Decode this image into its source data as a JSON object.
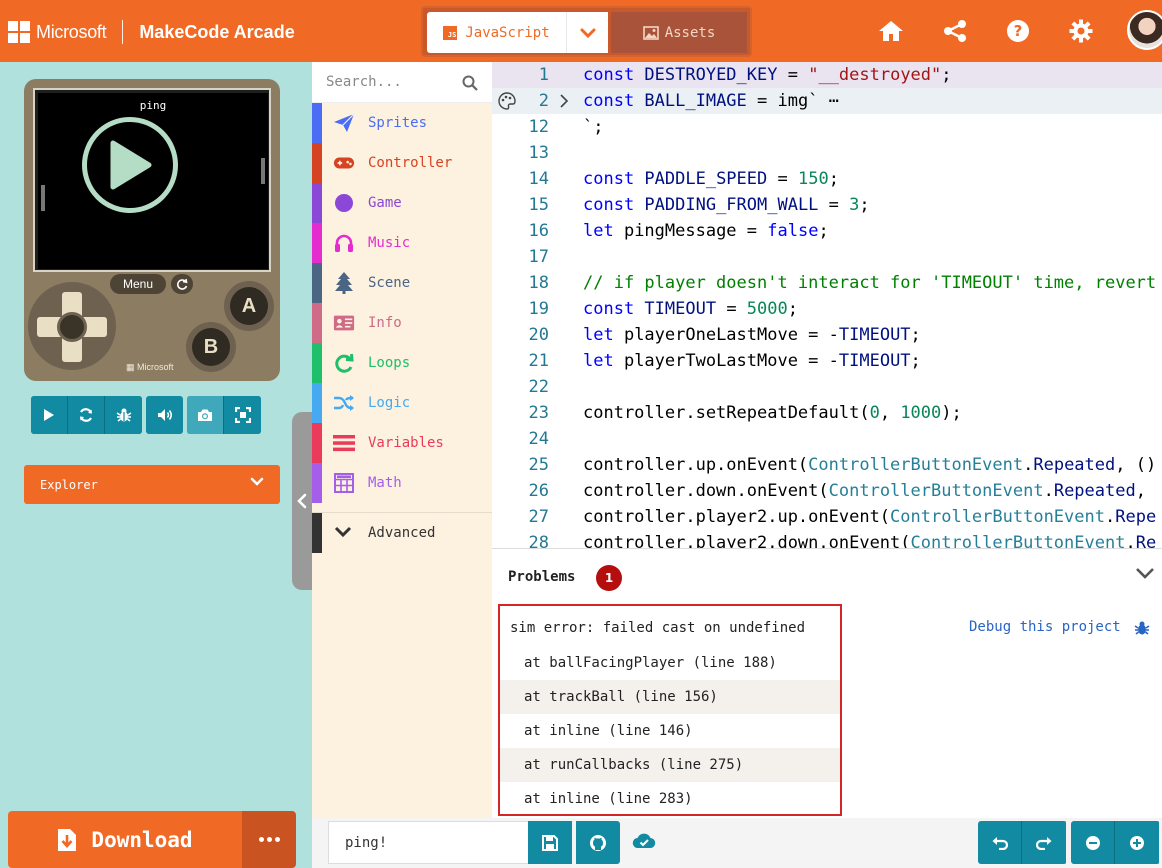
{
  "header": {
    "brand": "Microsoft",
    "app_name": "MakeCode Arcade",
    "lang_tab": "JavaScript",
    "lang_icon": "JS",
    "assets_tab": "Assets",
    "accent": "#f06a25",
    "icons": [
      "home-icon",
      "share-icon",
      "help-icon",
      "settings-icon",
      "avatar"
    ]
  },
  "simulator": {
    "game_title": "ping",
    "menu_label": "Menu",
    "a_label": "A",
    "b_label": "B",
    "console_brand": "Microsoft",
    "toolbar": [
      "play-icon",
      "restart-icon",
      "debug-icon",
      "sound-icon",
      "screenshot-icon",
      "fullscreen-icon"
    ]
  },
  "explorer": {
    "label": "Explorer"
  },
  "download": {
    "label": "Download"
  },
  "toolbox": {
    "search_placeholder": "Search...",
    "categories": [
      {
        "label": "Sprites",
        "color": "#4b6cf5",
        "icon": "paper-plane-icon"
      },
      {
        "label": "Controller",
        "color": "#d54322",
        "icon": "gamepad-icon"
      },
      {
        "label": "Game",
        "color": "#8b48d6",
        "icon": "circle-icon"
      },
      {
        "label": "Music",
        "color": "#e52dcf",
        "icon": "headphones-icon"
      },
      {
        "label": "Scene",
        "color": "#4b6584",
        "icon": "tree-icon"
      },
      {
        "label": "Info",
        "color": "#cf6a87",
        "icon": "id-card-icon"
      },
      {
        "label": "Loops",
        "color": "#20bf6b",
        "icon": "refresh-icon"
      },
      {
        "label": "Logic",
        "color": "#45aaf2",
        "icon": "shuffle-icon"
      },
      {
        "label": "Variables",
        "color": "#eb3b5a",
        "icon": "list-icon"
      },
      {
        "label": "Math",
        "color": "#a55eea",
        "icon": "calculator-icon"
      }
    ],
    "advanced": "Advanced"
  },
  "editor": {
    "lines": [
      {
        "num": "1",
        "tokens": [
          [
            "kw",
            "const "
          ],
          [
            "id",
            "DESTROYED_KEY"
          ],
          [
            "pl",
            " = "
          ],
          [
            "str",
            "\"__destroyed\""
          ],
          [
            "pl",
            ";"
          ]
        ]
      },
      {
        "num": "2",
        "tokens": [
          [
            "kw",
            "const "
          ],
          [
            "id",
            "BALL_IMAGE"
          ],
          [
            "pl",
            " = "
          ],
          [
            "pl",
            "img`"
          ],
          [
            "pl",
            " ⋯"
          ]
        ]
      },
      {
        "num": "12",
        "tokens": [
          [
            "pl",
            "`;"
          ]
        ]
      },
      {
        "num": "13",
        "tokens": []
      },
      {
        "num": "14",
        "tokens": [
          [
            "kw",
            "const "
          ],
          [
            "id",
            "PADDLE_SPEED"
          ],
          [
            "pl",
            " = "
          ],
          [
            "nm",
            "150"
          ],
          [
            "pl",
            ";"
          ]
        ]
      },
      {
        "num": "15",
        "tokens": [
          [
            "kw",
            "const "
          ],
          [
            "id",
            "PADDING_FROM_WALL"
          ],
          [
            "pl",
            " = "
          ],
          [
            "nm",
            "3"
          ],
          [
            "pl",
            ";"
          ]
        ]
      },
      {
        "num": "16",
        "tokens": [
          [
            "kw",
            "let "
          ],
          [
            "pl",
            "pingMessage = "
          ],
          [
            "kw",
            "false"
          ],
          [
            "pl",
            ";"
          ]
        ]
      },
      {
        "num": "17",
        "tokens": []
      },
      {
        "num": "18",
        "tokens": [
          [
            "cm",
            "// if player doesn't interact for 'TIMEOUT' time, revert"
          ]
        ]
      },
      {
        "num": "19",
        "tokens": [
          [
            "kw",
            "const "
          ],
          [
            "id",
            "TIMEOUT"
          ],
          [
            "pl",
            " = "
          ],
          [
            "nm",
            "5000"
          ],
          [
            "pl",
            ";"
          ]
        ]
      },
      {
        "num": "20",
        "tokens": [
          [
            "kw",
            "let "
          ],
          [
            "pl",
            "playerOneLastMove = -"
          ],
          [
            "id",
            "TIMEOUT"
          ],
          [
            "pl",
            ";"
          ]
        ]
      },
      {
        "num": "21",
        "tokens": [
          [
            "kw",
            "let "
          ],
          [
            "pl",
            "playerTwoLastMove = -"
          ],
          [
            "id",
            "TIMEOUT"
          ],
          [
            "pl",
            ";"
          ]
        ]
      },
      {
        "num": "22",
        "tokens": []
      },
      {
        "num": "23",
        "tokens": [
          [
            "pl",
            "controller.setRepeatDefault("
          ],
          [
            "nm",
            "0"
          ],
          [
            "pl",
            ", "
          ],
          [
            "nm",
            "1000"
          ],
          [
            "pl",
            ");"
          ]
        ]
      },
      {
        "num": "24",
        "tokens": []
      },
      {
        "num": "25",
        "tokens": [
          [
            "pl",
            "controller.up.onEvent("
          ],
          [
            "ty",
            "ControllerButtonEvent"
          ],
          [
            "pl",
            "."
          ],
          [
            "id",
            "Repeated"
          ],
          [
            "pl",
            ", ()"
          ]
        ]
      },
      {
        "num": "26",
        "tokens": [
          [
            "pl",
            "controller.down.onEvent("
          ],
          [
            "ty",
            "ControllerButtonEvent"
          ],
          [
            "pl",
            "."
          ],
          [
            "id",
            "Repeated"
          ],
          [
            "pl",
            ","
          ]
        ]
      },
      {
        "num": "27",
        "tokens": [
          [
            "pl",
            "controller.player2.up.onEvent("
          ],
          [
            "ty",
            "ControllerButtonEvent"
          ],
          [
            "pl",
            "."
          ],
          [
            "id",
            "Repe"
          ]
        ]
      },
      {
        "num": "28",
        "tokens": [
          [
            "pl",
            "controller.player2.down.onEvent("
          ],
          [
            "ty",
            "ControllerButtonEvent"
          ],
          [
            "pl",
            "."
          ],
          [
            "id",
            "Re"
          ]
        ]
      }
    ]
  },
  "problems": {
    "title": "Problems",
    "count": "1",
    "error": "sim error: failed cast on undefined",
    "trace": [
      "at ballFacingPlayer (line 188)",
      "at trackBall (line 156)",
      "at inline (line 146)",
      "at runCallbacks (line 275)",
      "at inline (line 283)"
    ],
    "debug_link": "Debug this project"
  },
  "bottom": {
    "project_name": "ping!"
  }
}
